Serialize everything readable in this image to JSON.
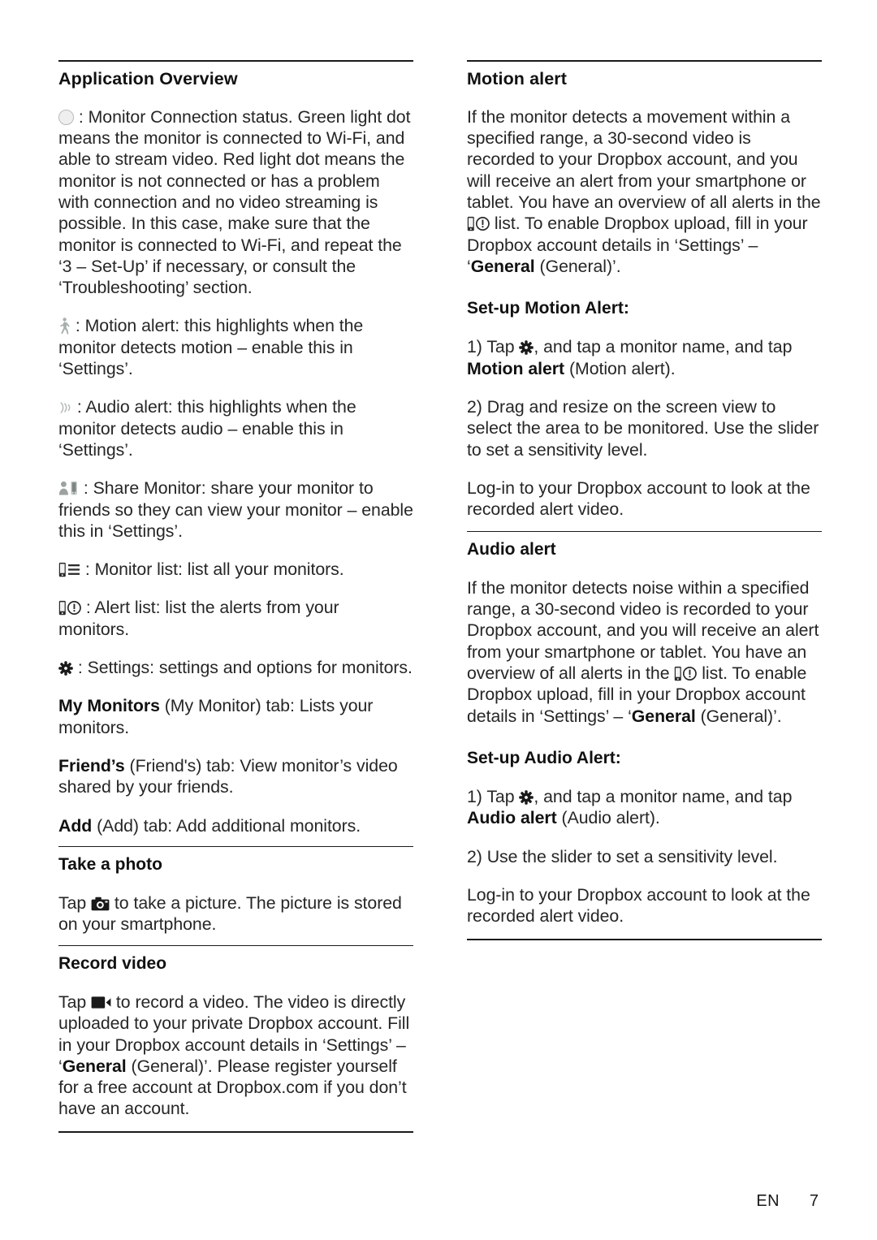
{
  "footer": {
    "language": "EN",
    "page_number": "7"
  },
  "left_column": {
    "section_title": "Application Overview",
    "entries": [
      {
        "icon": "status-dot-icon",
        "text": " : Monitor Connection status. Green light dot means the monitor is connected to Wi-Fi, and able to stream video. Red light dot means the monitor is not connected or has a problem with connection and no video streaming is possible. In this case, make sure that the monitor is connected to Wi-Fi, and repeat the ‘3 – Set-Up’ if necessary, or consult the ‘Troubleshooting’ section."
      },
      {
        "icon": "motion-alert-icon",
        "text": " : Motion alert: this highlights when the monitor detects motion – enable this in ‘Settings’."
      },
      {
        "icon": "audio-alert-icon",
        "text": " : Audio alert: this highlights when the monitor detects audio – enable this in ‘Settings’."
      },
      {
        "icon": "share-monitor-icon",
        "text": " : Share Monitor: share your monitor to friends so they can view your monitor – enable this in ‘Settings’."
      },
      {
        "icon": "monitor-list-icon",
        "text": " : Monitor list: list all your monitors."
      },
      {
        "icon": "alert-list-icon",
        "text": " : Alert list: list the alerts from your monitors."
      },
      {
        "icon": "settings-gear-icon",
        "text": " : Settings: settings and options for monitors."
      }
    ],
    "tabs": [
      {
        "bold": "My Monitors",
        "rest": " (My Monitor) tab: Lists your monitors."
      },
      {
        "bold": "Friend’s",
        "rest": " (Friend's) tab: View monitor’s video shared by your friends."
      },
      {
        "bold": "Add",
        "rest": " (Add) tab: Add additional monitors."
      }
    ],
    "take_photo": {
      "title": "Take a photo",
      "text_before_icon": "Tap ",
      "icon": "camera-icon",
      "text_after_icon": " to take a picture. The picture is stored on your smartphone."
    },
    "record_video": {
      "title": "Record video",
      "text_before_icon": "Tap ",
      "icon": "video-camera-icon",
      "text_part1": " to record a video. The video is directly uploaded to your private Dropbox account. Fill in your Dropbox account details in ‘Settings’ – ‘",
      "bold_general": "General",
      "text_part2": " (General)’. Please register yourself for a free account at Dropbox.com if you don’t have an account."
    }
  },
  "right_column": {
    "motion_alert": {
      "title": "Motion alert",
      "body_part1": "If the monitor detects a movement within a specified range, a 30-second video is recorded to your Dropbox account, and you will receive an alert from your smartphone or tablet. You have an overview of all alerts in the ",
      "inline_icon": "alert-list-icon",
      "body_part2": " list. To enable Dropbox upload, fill in your Dropbox account details in ‘Settings’ – ‘",
      "bold_general": "General",
      "body_part3": " (General)’.",
      "setup_title": "Set-up Motion Alert:",
      "step1_before_icon": "1) Tap ",
      "step1_icon": "settings-gear-icon",
      "step1_middle": ", and tap a monitor name, and tap ",
      "step1_bold": "Motion alert",
      "step1_after": " (Motion alert).",
      "step2": "2) Drag and resize on the screen view to select the area to be monitored. Use the slider to set a sensitivity level.",
      "login_note": "Log-in to your Dropbox account to look at the recorded alert video."
    },
    "audio_alert": {
      "title": "Audio alert",
      "body_part1": "If the monitor detects noise within a specified range, a 30-second video is recorded to your Dropbox account, and you will receive an alert from your smartphone or tablet. You have an overview of all alerts in the ",
      "inline_icon": "alert-list-icon",
      "body_part2": " list. To enable Dropbox upload, fill in your Dropbox account details in ‘Settings’ – ‘",
      "bold_general": "General",
      "body_part3": " (General)’.",
      "setup_title": "Set-up Audio Alert:",
      "step1_before_icon": "1) Tap ",
      "step1_icon": "settings-gear-icon",
      "step1_middle": ", and tap a monitor name, and tap ",
      "step1_bold": "Audio alert",
      "step1_after": " (Audio alert).",
      "step2": "2) Use the slider to set a sensitivity level.",
      "login_note": "Log-in to your Dropbox account to look at the recorded alert video."
    }
  }
}
